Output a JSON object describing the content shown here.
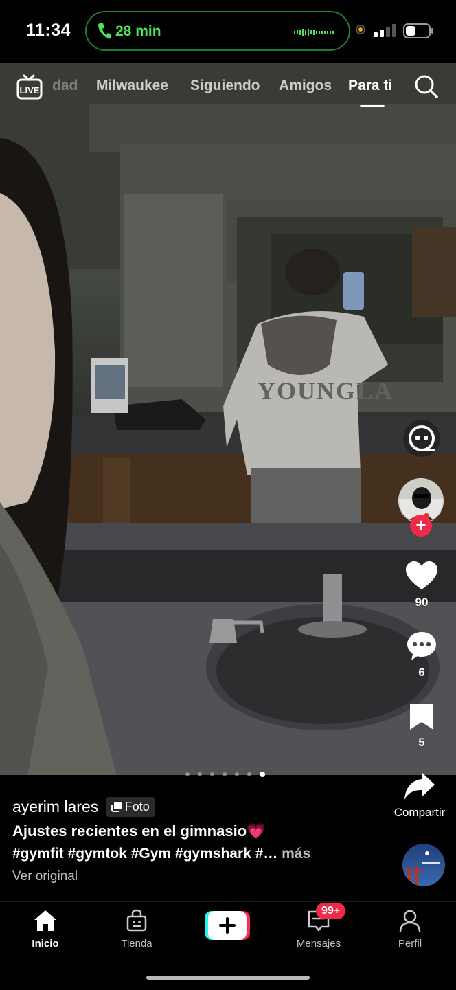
{
  "status_bar": {
    "time": "11:34",
    "call_duration": "28 min",
    "call_color": "#4ee15a"
  },
  "feed_nav": {
    "live_label": "LIVE",
    "tabs": [
      {
        "label": "dad",
        "state": "faded"
      },
      {
        "label": "Milwaukee",
        "state": "normal"
      },
      {
        "label": "Siguiendo",
        "state": "normal"
      },
      {
        "label": "Amigos",
        "state": "normal"
      },
      {
        "label": "Para ti",
        "state": "active"
      }
    ],
    "search_icon": "search-icon"
  },
  "post": {
    "likes": "90",
    "comments": "6",
    "saves": "5",
    "share_label": "Compartir",
    "carousel": {
      "total": 7,
      "active_index": 6
    },
    "author": "ayerim lares",
    "type_badge": "Foto",
    "title": "Ajustes recientes en el gimnasio💗",
    "hashtags": "#gymfit #gymtok #Gym #gymshark #…",
    "more_label": "más",
    "view_original": "Ver original"
  },
  "bottom_nav": {
    "items": [
      {
        "label": "Inicio",
        "icon": "home-icon",
        "active": true
      },
      {
        "label": "Tienda",
        "icon": "shop-icon",
        "active": false
      },
      {
        "label": "Mensajes",
        "icon": "inbox-icon",
        "active": false,
        "badge": "99+"
      },
      {
        "label": "Perfil",
        "icon": "profile-icon",
        "active": false
      }
    ]
  },
  "colors": {
    "accent_red": "#f02a4a",
    "tiktok_cyan": "#25f4ee",
    "tiktok_pink": "#fe2c55"
  }
}
